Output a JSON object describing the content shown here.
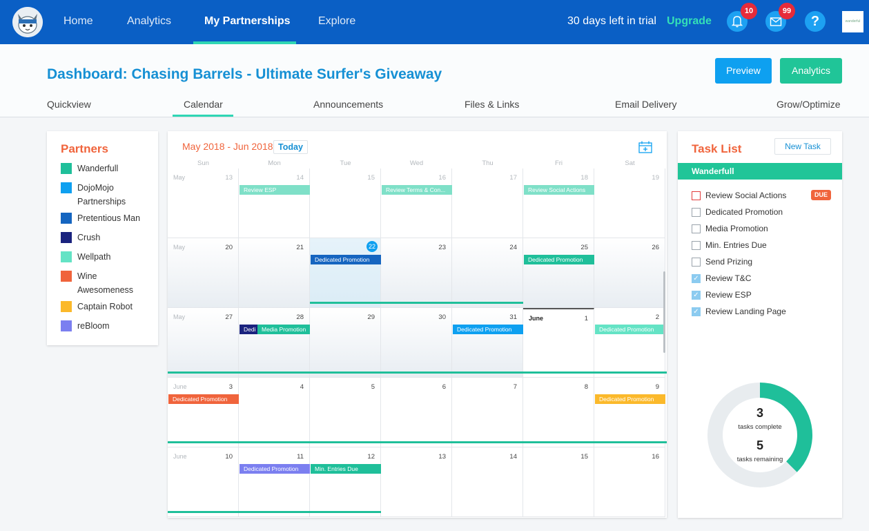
{
  "nav": {
    "links": [
      "Home",
      "Analytics",
      "My Partnerships",
      "Explore"
    ],
    "active": "My Partnerships",
    "trial_text": "30 days left in trial",
    "upgrade_label": "Upgrade",
    "notifications_count": "10",
    "messages_count": "99",
    "help_label": "?",
    "brand_tile_text": "wanderful"
  },
  "header": {
    "title": "Dashboard: Chasing Barrels - Ultimate Surfer's Giveaway",
    "preview_label": "Preview",
    "analytics_label": "Analytics",
    "tabs": [
      "Quickview",
      "Calendar",
      "Announcements",
      "Files & Links",
      "Email Delivery",
      "Grow/Optimize"
    ],
    "active_tab": "Calendar"
  },
  "partners": {
    "title": "Partners",
    "items": [
      {
        "name": "Wanderfull",
        "color": "#1fbf9a"
      },
      {
        "name": "DojoMojo Partnerships",
        "color": "#0ea0f0"
      },
      {
        "name": "Pretentious Man",
        "color": "#1565c0"
      },
      {
        "name": "Crush",
        "color": "#1a237e"
      },
      {
        "name": "Wellpath",
        "color": "#64e3c5"
      },
      {
        "name": "Wine Awesomeness",
        "color": "#f0643c"
      },
      {
        "name": "Captain Robot",
        "color": "#fbb92b"
      },
      {
        "name": "reBloom",
        "color": "#7b7ff0"
      }
    ]
  },
  "calendar": {
    "range": "May 2018 - Jun 2018",
    "today_label": "Today",
    "weekdays": [
      "Sun",
      "Mon",
      "Tue",
      "Wed",
      "Thu",
      "Fri",
      "Sat"
    ],
    "weeks": [
      [
        {
          "m": "May",
          "d": "13"
        },
        {
          "d": "14"
        },
        {
          "d": "15"
        },
        {
          "d": "16"
        },
        {
          "d": "17"
        },
        {
          "d": "18"
        },
        {
          "d": "19"
        }
      ],
      [
        {
          "m": "May",
          "d": "20"
        },
        {
          "d": "21"
        },
        {
          "d": "22"
        },
        {
          "d": "23"
        },
        {
          "d": "24"
        },
        {
          "d": "25"
        },
        {
          "d": "26"
        }
      ],
      [
        {
          "m": "May",
          "d": "27"
        },
        {
          "d": "28"
        },
        {
          "d": "29"
        },
        {
          "d": "30"
        },
        {
          "d": "31"
        },
        {
          "m": "June",
          "d": "1"
        },
        {
          "d": "2"
        }
      ],
      [
        {
          "m": "June",
          "d": "3"
        },
        {
          "d": "4"
        },
        {
          "d": "5"
        },
        {
          "d": "6"
        },
        {
          "d": "7"
        },
        {
          "d": "8"
        },
        {
          "d": "9"
        }
      ],
      [
        {
          "m": "June",
          "d": "10"
        },
        {
          "d": "11"
        },
        {
          "d": "12"
        },
        {
          "d": "13"
        },
        {
          "d": "14"
        },
        {
          "d": "15"
        },
        {
          "d": "16"
        }
      ]
    ],
    "events": [
      {
        "week": 0,
        "day": 1,
        "label": "Review ESP",
        "color": "#7fe0c8"
      },
      {
        "week": 0,
        "day": 3,
        "label": "Review Terms & Con...",
        "color": "#7fe0c8"
      },
      {
        "week": 0,
        "day": 5,
        "label": "Review Social Actions",
        "color": "#7fe0c8"
      },
      {
        "week": 1,
        "day": 2,
        "label": "Dedicated Promotion",
        "color": "#1565c0"
      },
      {
        "week": 1,
        "day": 5,
        "label": "Dedicated Promotion",
        "color": "#1fbf9a"
      },
      {
        "week": 2,
        "day": 1,
        "label": "Dedi",
        "color": "#1a237e"
      },
      {
        "week": 2,
        "day": 1,
        "offset": 26,
        "label": "Media Promotion",
        "color": "#1fbf9a"
      },
      {
        "week": 2,
        "day": 4,
        "label": "Dedicated Promotion",
        "color": "#0ea0f0"
      },
      {
        "week": 2,
        "day": 6,
        "label": "Dedicated Promotion",
        "color": "#64e3c5"
      },
      {
        "week": 3,
        "day": 0,
        "label": "Dedicated Promotion",
        "color": "#f0643c"
      },
      {
        "week": 3,
        "day": 6,
        "label": "Dedicated Promotion",
        "color": "#fbb92b"
      },
      {
        "week": 4,
        "day": 1,
        "label": "Dedicated Promotion",
        "color": "#7b7ff0"
      },
      {
        "week": 4,
        "day": 2,
        "label": "Min. Entries Due",
        "color": "#1fbf9a"
      }
    ]
  },
  "tasks": {
    "title": "Task List",
    "new_task_label": "New Task",
    "group": "Wanderfull",
    "items": [
      {
        "label": "Review Social Actions",
        "state": "due",
        "badge": "DUE"
      },
      {
        "label": "Dedicated Promotion",
        "state": "open"
      },
      {
        "label": "Media Promotion",
        "state": "open"
      },
      {
        "label": "Min. Entries Due",
        "state": "open"
      },
      {
        "label": "Send Prizing",
        "state": "open"
      },
      {
        "label": "Review T&C",
        "state": "done"
      },
      {
        "label": "Review ESP",
        "state": "done"
      },
      {
        "label": "Review Landing Page",
        "state": "done"
      }
    ],
    "complete_count": "3",
    "complete_label": "tasks complete",
    "remaining_count": "5",
    "remaining_label": "tasks remaining",
    "progress_fraction": 0.375,
    "progress_color": "#1fbf9a",
    "track_color": "#e8ecef"
  }
}
